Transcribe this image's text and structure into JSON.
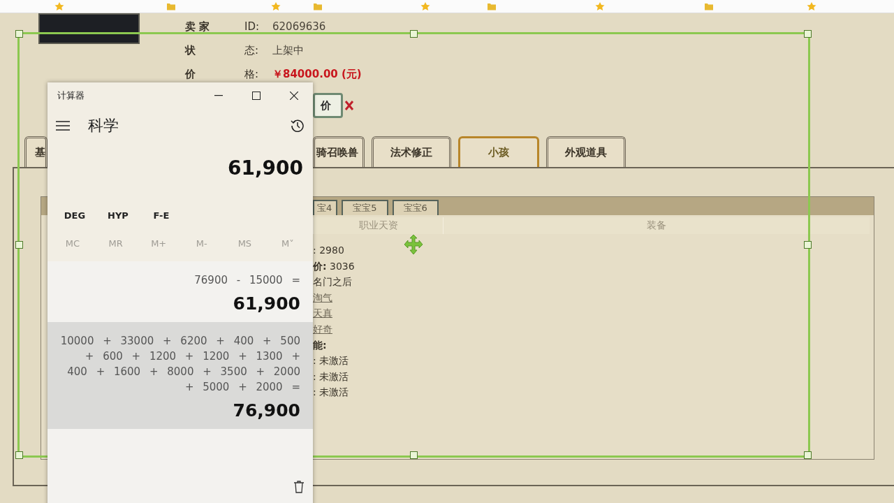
{
  "listing": {
    "fields": [
      {
        "label": "卖 家",
        "suffix": "ID:",
        "value": "62069636",
        "kind": "plain"
      },
      {
        "label": "状",
        "suffix": "态:",
        "value": "上架中",
        "kind": "plain"
      },
      {
        "label": "价",
        "suffix": "格:",
        "value": "￥84000.00 (元)",
        "kind": "price"
      }
    ],
    "button": "价"
  },
  "tabs": [
    {
      "label": "基",
      "selected": false
    },
    {
      "label": "骑召唤兽",
      "selected": false
    },
    {
      "label": "法术修正",
      "selected": false
    },
    {
      "label": "小孩",
      "selected": true
    },
    {
      "label": "外观道具",
      "selected": false
    }
  ],
  "child_tabs": [
    {
      "label": "宝4",
      "selected": false
    },
    {
      "label": "宝宝5",
      "selected": false
    },
    {
      "label": "宝宝6",
      "selected": false
    }
  ],
  "columns": [
    "职业天资",
    "装备"
  ],
  "details": [
    {
      "text": ": 2980",
      "kind": "plain"
    },
    {
      "text": "**价:** 3036",
      "kind": "plain"
    },
    {
      "text": "名门之后",
      "kind": "plain"
    },
    {
      "text": "淘气",
      "kind": "link"
    },
    {
      "text": "天真",
      "kind": "link"
    },
    {
      "text": "好奇",
      "kind": "link"
    },
    {
      "text": "**能:**",
      "kind": "plain"
    },
    {
      "text": ": 未激活",
      "kind": "plain"
    },
    {
      "text": ": 未激活",
      "kind": "plain"
    },
    {
      "text": ": 未激活",
      "kind": "plain"
    }
  ],
  "calculator": {
    "title": "计算器",
    "mode": "科学",
    "display": "61,900",
    "options": [
      "DEG",
      "HYP",
      "F-E"
    ],
    "memory": [
      {
        "label": "MC",
        "disabled": true
      },
      {
        "label": "MR",
        "disabled": true
      },
      {
        "label": "M+",
        "disabled": true
      },
      {
        "label": "M-",
        "disabled": true
      },
      {
        "label": "MS",
        "disabled": true
      },
      {
        "label": "M˅",
        "disabled": true
      }
    ],
    "history": [
      {
        "expression": "76900 - 15000 =",
        "result": "61,900",
        "hovered": false
      },
      {
        "expression": "10000 + 33000 + 6200 + 400 + 500 + 600 + 1200 + 1200 + 1300 + 400 + 1600 + 8000 + 3500 + 2000 + 5000 + 2000 =",
        "result": "76,900",
        "hovered": true
      }
    ]
  }
}
